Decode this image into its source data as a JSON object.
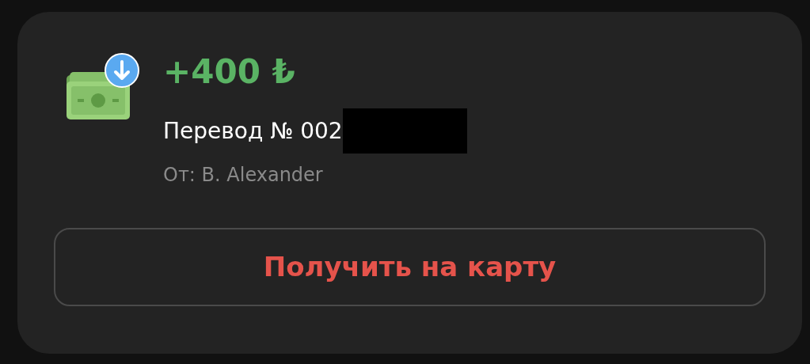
{
  "transfer": {
    "amount": "+400 ₺",
    "title": "Перевод № 002",
    "sender": "От: B. Alexander"
  },
  "button": {
    "label": "Получить на карту"
  }
}
